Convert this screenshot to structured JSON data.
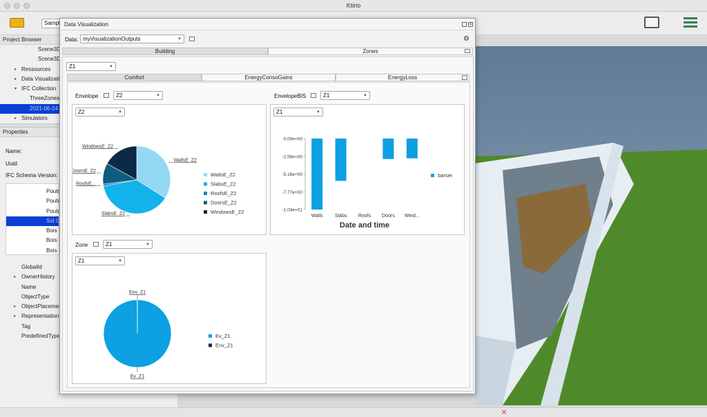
{
  "app": {
    "title": "Ktirio"
  },
  "toolbar": {
    "scene_combo": "Sampl"
  },
  "project_browser": {
    "title": "Project Browser",
    "items": [
      {
        "label": "Scene3D"
      },
      {
        "label": "Scene3D"
      },
      {
        "label": "Ressources"
      },
      {
        "label": "Data Visualizati"
      },
      {
        "label": "IFC Collection"
      },
      {
        "label": "ThreeZones"
      },
      {
        "label": "2021-06-24 ("
      },
      {
        "label": "Simulators"
      }
    ]
  },
  "properties": {
    "title": "Properties",
    "fields": [
      {
        "label": "Name:"
      },
      {
        "label": "Uuid:"
      },
      {
        "label": "IFC Schema Version:"
      }
    ],
    "list": [
      "Poutre",
      "Poutre",
      "Poutre",
      "Sol G",
      "Bois -",
      "Bois -",
      "Bois -"
    ],
    "attributes": [
      "GlobalId",
      "OwnerHistory",
      "Name",
      "ObjectType",
      "ObjectPlacemen",
      "Representation",
      "Tag",
      "PredefinedType"
    ]
  },
  "dialog": {
    "title": "Data Visualization",
    "data_label": "Data:",
    "data_value": "myVisualizationOutputs",
    "top_tabs": [
      "Building",
      "Zones"
    ],
    "zone_combo": "Z1",
    "sub_tabs": [
      "Comfort",
      "EnergyConsoGains",
      "EnergyLoss"
    ],
    "envelope": {
      "label": "Envelope",
      "combo": "Z2",
      "inner_combo": "Z2"
    },
    "envelope_bis": {
      "label": "EnvelopeBIS",
      "combo": "Z1",
      "inner_combo": "Z1"
    },
    "zone": {
      "label": "Zone",
      "combo": "Z1",
      "inner_combo": "Z1"
    }
  },
  "colors": {
    "c1": "#93d8f5",
    "c2": "#14b2ea",
    "c3": "#1488b8",
    "c4": "#0f5c80",
    "c5": "#0c2a45",
    "bar": "#0da0e2"
  },
  "chart_data": [
    {
      "type": "pie",
      "labels": [
        "WallsE_Z2",
        "SlabsE_Z2",
        "RoofsE_Z2",
        "DoorsE_Z2",
        "WindowsE_Z2"
      ],
      "slice_labels": [
        "WallsE_Z2",
        "SlabsE_Z2",
        "RoofsE...",
        "DoorsE_Z2",
        "WindowsE_Z2"
      ],
      "values": [
        34,
        38,
        1,
        10,
        17
      ],
      "legend": "right"
    },
    {
      "type": "bar",
      "categories": [
        "Walls",
        "Slabs",
        "Roofs",
        "Doors",
        "Wind..."
      ],
      "values": [
        -10.4,
        -6.2,
        0,
        -3.0,
        -2.9
      ],
      "series_name": "barset",
      "xlabel": "Date and time",
      "ylim": [
        -10.4,
        0
      ],
      "yticks": [
        "0.00e+00",
        "-2.59e+00",
        "-5.18e+00",
        "-7.77e+00",
        "-1.04e+01"
      ],
      "legend": "right"
    },
    {
      "type": "pie",
      "labels": [
        "Ev_Z1",
        "Env_Z1"
      ],
      "values": [
        99.9,
        0.1
      ],
      "legend": "right"
    }
  ]
}
